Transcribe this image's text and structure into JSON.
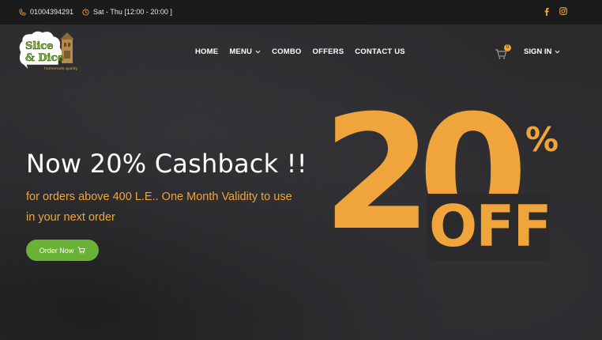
{
  "topbar": {
    "phone": "01004394291",
    "hours": "Sat - Thu [12:00 - 20:00 ]",
    "social": [
      "facebook-icon",
      "instagram-icon"
    ]
  },
  "brand": {
    "logo_line1": "Slice",
    "logo_line2": "& Dice",
    "logo_tagline": "homemade quality"
  },
  "nav": {
    "home": "HOME",
    "menu": "MENU",
    "combo": "COMBO",
    "offers": "OFFERS",
    "contact": "CONTACT US",
    "signin": "SIGN IN",
    "cart_count": "0"
  },
  "hero": {
    "headline": "Now 20% Cashback !!",
    "subline": "for orders above 400 L.E.. One Month Validity to use in your next order",
    "button": "Order Now",
    "promo_number": "20",
    "promo_percent": "%",
    "promo_off": "OFF"
  },
  "colors": {
    "accent": "#f0a43c",
    "button": "#6ab235",
    "topbar": "#1b1b1c",
    "background": "#2b2b2e"
  }
}
